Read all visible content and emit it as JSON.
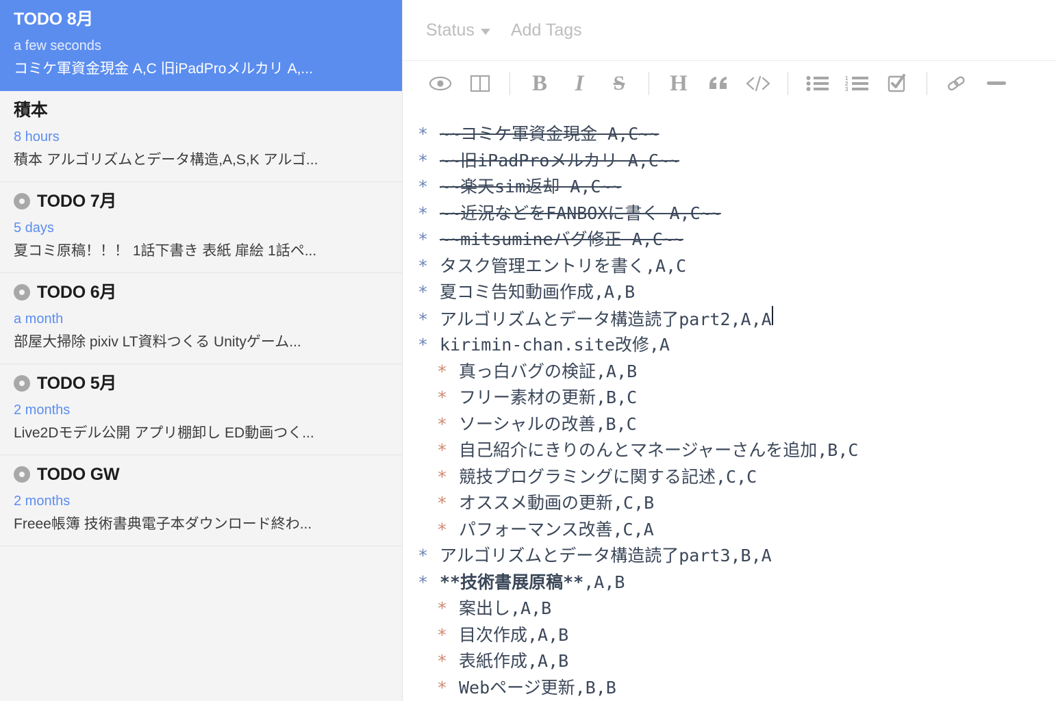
{
  "sidebar": {
    "notes": [
      {
        "title": "TODO 8月",
        "time": "a few seconds",
        "preview": "コミケ軍資金現金 A,C 旧iPadProメルカリ A,...",
        "selected": true,
        "pinned": false
      },
      {
        "title": "積本",
        "time": "8 hours",
        "preview": "積本 アルゴリズムとデータ構造,A,S,K アルゴ...",
        "selected": false,
        "pinned": false
      },
      {
        "title": "TODO 7月",
        "time": "5 days",
        "preview": "夏コミ原稿！！！ 1話下書き 表紙 扉絵 1話ペ...",
        "selected": false,
        "pinned": true
      },
      {
        "title": "TODO 6月",
        "time": "a month",
        "preview": "部屋大掃除 pixiv LT資料つくる Unityゲーム...",
        "selected": false,
        "pinned": true
      },
      {
        "title": "TODO 5月",
        "time": "2 months",
        "preview": "Live2Dモデル公開 アプリ棚卸し ED動画つく...",
        "selected": false,
        "pinned": true
      },
      {
        "title": "TODO GW",
        "time": "2 months",
        "preview": "Freee帳簿 技術書典電子本ダウンロード終わ...",
        "selected": false,
        "pinned": true
      }
    ]
  },
  "meta": {
    "status_label": "Status",
    "add_tags_label": "Add Tags"
  },
  "toolbar": {
    "items": [
      {
        "icon": "eye-icon",
        "label": ""
      },
      {
        "icon": "split-view-icon",
        "label": ""
      },
      {
        "icon": "separator",
        "label": ""
      },
      {
        "icon": "bold-icon",
        "label": "B"
      },
      {
        "icon": "italic-icon",
        "label": "I"
      },
      {
        "icon": "strikethrough-icon",
        "label": "S"
      },
      {
        "icon": "separator",
        "label": ""
      },
      {
        "icon": "heading-icon",
        "label": "H"
      },
      {
        "icon": "quote-icon",
        "label": "“"
      },
      {
        "icon": "code-icon",
        "label": "</>"
      },
      {
        "icon": "separator",
        "label": ""
      },
      {
        "icon": "bulleted-list-icon",
        "label": ""
      },
      {
        "icon": "numbered-list-icon",
        "label": ""
      },
      {
        "icon": "checklist-icon",
        "label": ""
      },
      {
        "icon": "separator",
        "label": ""
      },
      {
        "icon": "link-icon",
        "label": ""
      },
      {
        "icon": "horizontal-rule-icon",
        "label": ""
      }
    ]
  },
  "editor": {
    "lines": [
      {
        "level": 1,
        "bullet": "*",
        "text": "~~コミケ軍資金現金  A,C~~",
        "strike": true
      },
      {
        "level": 1,
        "bullet": "*",
        "text": "~~旧iPadProメルカリ  A,C~~",
        "strike": true
      },
      {
        "level": 1,
        "bullet": "*",
        "text": "~~楽天sim返却  A,C~~",
        "strike": true
      },
      {
        "level": 1,
        "bullet": "*",
        "text": "~~近況などをFANBOXに書く  A,C~~",
        "strike": true
      },
      {
        "level": 1,
        "bullet": "*",
        "text": "~~mitsumineバグ修正  A,C~~",
        "strike": true
      },
      {
        "level": 1,
        "bullet": "*",
        "text": "タスク管理エントリを書く,A,C",
        "strike": false
      },
      {
        "level": 1,
        "bullet": "*",
        "text": "夏コミ告知動画作成,A,B",
        "strike": false
      },
      {
        "level": 1,
        "bullet": "*",
        "text": "アルゴリズムとデータ構造読了part2,A,A",
        "strike": false,
        "caret": true
      },
      {
        "level": 1,
        "bullet": "*",
        "text": "kirimin-chan.site改修,A",
        "strike": false
      },
      {
        "level": 2,
        "bullet": "*",
        "text": "真っ白バグの検証,A,B",
        "strike": false
      },
      {
        "level": 2,
        "bullet": "*",
        "text": "フリー素材の更新,B,C",
        "strike": false
      },
      {
        "level": 2,
        "bullet": "*",
        "text": "ソーシャルの改善,B,C",
        "strike": false
      },
      {
        "level": 2,
        "bullet": "*",
        "text": "自己紹介にきりのんとマネージャーさんを追加,B,C",
        "strike": false
      },
      {
        "level": 2,
        "bullet": "*",
        "text": "競技プログラミングに関する記述,C,C",
        "strike": false
      },
      {
        "level": 2,
        "bullet": "*",
        "text": "オススメ動画の更新,C,B",
        "strike": false
      },
      {
        "level": 2,
        "bullet": "*",
        "text": "パフォーマンス改善,C,A",
        "strike": false
      },
      {
        "level": 1,
        "bullet": "*",
        "text": "アルゴリズムとデータ構造読了part3,B,A",
        "strike": false
      },
      {
        "level": 1,
        "bullet": "*",
        "text": "**技術書展原稿**,A,B",
        "strike": false,
        "bold_segment": "**技術書展原稿**",
        "bold_tail": ",A,B"
      },
      {
        "level": 2,
        "bullet": "*",
        "text": "案出し,A,B",
        "strike": false
      },
      {
        "level": 2,
        "bullet": "*",
        "text": "目次作成,A,B",
        "strike": false
      },
      {
        "level": 2,
        "bullet": "*",
        "text": "表紙作成,A,B",
        "strike": false
      },
      {
        "level": 2,
        "bullet": "*",
        "text": "Webページ更新,B,B",
        "strike": false
      }
    ]
  },
  "colors": {
    "accent": "#5b8def",
    "sidebar_bg": "#f4f4f4",
    "editor_text": "#3b4759",
    "bullet_level1": "#6b86b8",
    "bullet_level2": "#cf8a70",
    "toolbar_icon": "#a6a6a6"
  }
}
